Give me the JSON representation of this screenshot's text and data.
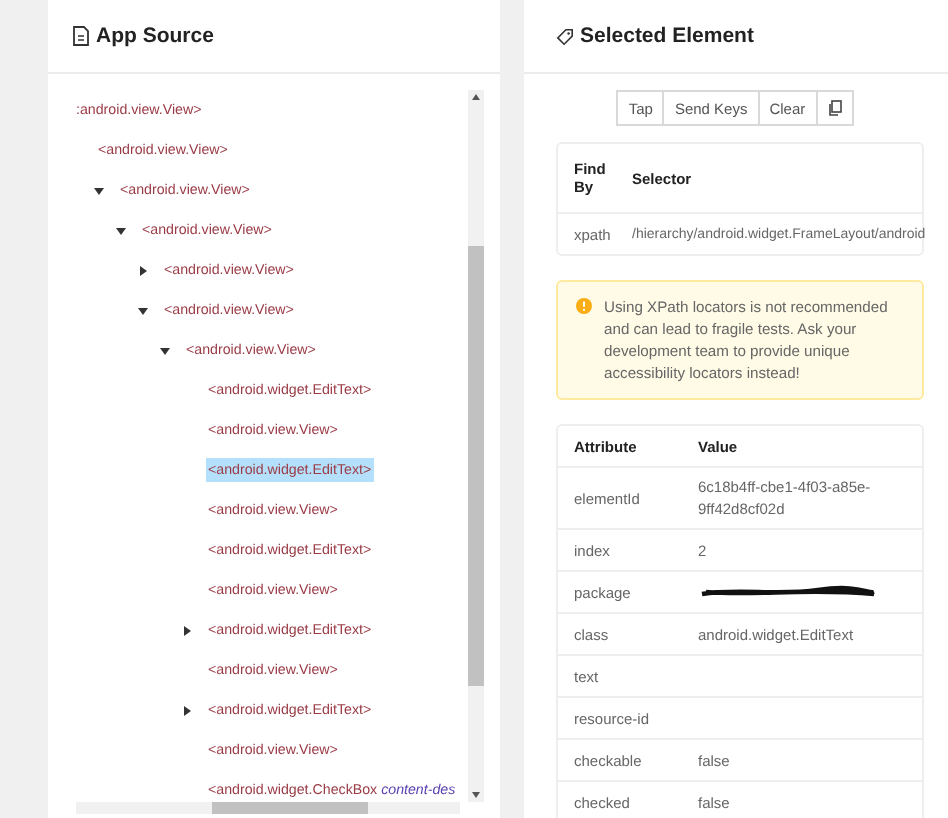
{
  "app_source": {
    "title": "App Source",
    "tree": [
      {
        "tag": ":android.view.View>",
        "selected": false,
        "children": [
          {
            "tag": "<android.view.View>",
            "selected": false,
            "children": [
              {
                "tag": "<android.view.View>",
                "expanded": true,
                "selected": false,
                "children": [
                  {
                    "tag": "<android.view.View>",
                    "expanded": true,
                    "selected": false,
                    "children": [
                      {
                        "tag": "<android.view.View>",
                        "expanded": false,
                        "selected": false
                      },
                      {
                        "tag": "<android.view.View>",
                        "expanded": true,
                        "selected": false,
                        "children": [
                          {
                            "tag": "<android.view.View>",
                            "expanded": true,
                            "selected": false,
                            "children": [
                              {
                                "tag": "<android.widget.EditText>",
                                "selected": false
                              },
                              {
                                "tag": "<android.view.View>",
                                "selected": false
                              },
                              {
                                "tag": "<android.widget.EditText>",
                                "selected": true
                              },
                              {
                                "tag": "<android.view.View>",
                                "selected": false
                              },
                              {
                                "tag": "<android.widget.EditText>",
                                "selected": false
                              },
                              {
                                "tag": "<android.view.View>",
                                "selected": false
                              },
                              {
                                "tag": "<android.widget.EditText>",
                                "expanded": false,
                                "selected": false
                              },
                              {
                                "tag": "<android.view.View>",
                                "selected": false
                              },
                              {
                                "tag": "<android.widget.EditText>",
                                "expanded": false,
                                "selected": false
                              },
                              {
                                "tag": "<android.view.View>",
                                "selected": false
                              },
                              {
                                "tag": "<android.widget.CheckBox",
                                "attr": "content-des",
                                "selected": false
                              }
                            ]
                          }
                        ]
                      }
                    ]
                  }
                ]
              }
            ]
          }
        ]
      }
    ]
  },
  "selected_element": {
    "title": "Selected Element",
    "actions": [
      {
        "kind": "text",
        "label": "Tap"
      },
      {
        "kind": "text",
        "label": "Send Keys"
      },
      {
        "kind": "text",
        "label": "Clear"
      },
      {
        "kind": "copy"
      }
    ],
    "selector_table": {
      "columns": [
        "Find By",
        "Selector"
      ],
      "rows": [
        [
          "xpath",
          "/hierarchy/android.widget.FrameLayout/android"
        ]
      ]
    },
    "warning": "Using XPath locators is not recommended and can lead to fragile tests. Ask your development team to provide unique accessibility locators instead!",
    "attributes": {
      "columns": [
        "Attribute",
        "Value"
      ],
      "rows": [
        {
          "name": "elementId",
          "value": "6c18b4ff-cbe1-4f03-a85e-9ff42d8cf02d",
          "redacted": false
        },
        {
          "name": "index",
          "value": "2",
          "redacted": false
        },
        {
          "name": "package",
          "redacted": true
        },
        {
          "name": "class",
          "value": "android.widget.EditText",
          "redacted": false
        },
        {
          "name": "text",
          "redacted": false
        },
        {
          "name": "resource-id",
          "redacted": false
        },
        {
          "name": "checkable",
          "value": "false",
          "redacted": false
        },
        {
          "name": "checked",
          "value": "false",
          "redacted": false
        }
      ]
    }
  }
}
